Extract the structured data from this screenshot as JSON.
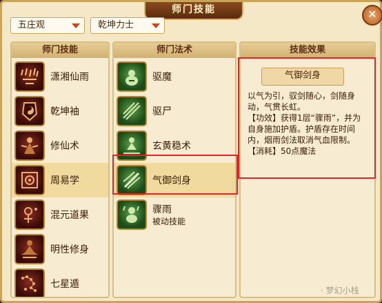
{
  "window": {
    "title": "师门技能",
    "close_label": "✕"
  },
  "filters": {
    "sect": "五庄观",
    "skill": "乾坤力士"
  },
  "columns": {
    "school_skills": "师门技能",
    "school_spells": "师门法术",
    "skill_effect": "技能效果"
  },
  "school_skills": [
    {
      "label": "潇湘仙雨",
      "icon": "rain-icon"
    },
    {
      "label": "乾坤袖",
      "icon": "yinyang-sleeve-icon"
    },
    {
      "label": "修仙术",
      "icon": "cultivation-icon"
    },
    {
      "label": "周易学",
      "icon": "bagua-icon",
      "selected": true
    },
    {
      "label": "混元道果",
      "icon": "dao-fruit-icon"
    },
    {
      "label": "明性修身",
      "icon": "meditation-icon"
    },
    {
      "label": "七星遁",
      "icon": "seven-stars-icon"
    }
  ],
  "school_spells": [
    {
      "label": "驱魔",
      "sub": "",
      "icon": "exorcism-gourd-icon"
    },
    {
      "label": "驱尸",
      "sub": "",
      "icon": "talisman-icon"
    },
    {
      "label": "玄黄稳术",
      "sub": "",
      "icon": "meditation-icon"
    },
    {
      "label": "气御剑身",
      "sub": "",
      "icon": "sword-qi-icon",
      "selected": true
    },
    {
      "label": "骤雨",
      "sub": "被动技能",
      "icon": "rain-gourd-icon"
    }
  ],
  "effect": {
    "name": "气御剑身",
    "description": "以气为引，驭剑随心，剑随身动，气贯长虹。\n【功效】获得1层“骤雨”，并为自身施加护盾。护盾存在时间内，烟雨剑法取消气血限制。\n【消耗】50点魔法"
  },
  "watermark": "· 梦幻小栈",
  "colors": {
    "highlight": "#e8202a",
    "selected_row": "#f0da9e",
    "panel": "#f7ecd2"
  }
}
